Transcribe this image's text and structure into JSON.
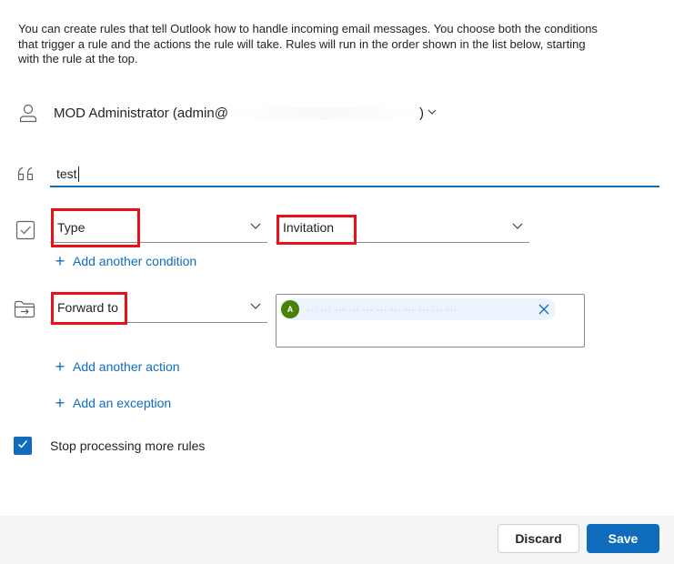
{
  "intro_text": "You can create rules that tell Outlook how to handle incoming email messages. You choose both the conditions that trigger a rule and the actions the rule will take. Rules will run in the order shown in the list below, starting with the rule at the top.",
  "account": {
    "label": "MOD Administrator (admin@",
    "suffix": ")",
    "icon": "person-icon"
  },
  "rule_name": {
    "value": "test",
    "icon": "quote-icon"
  },
  "condition": {
    "icon": "checkbox-icon",
    "type_value": "Type",
    "value": "Invitation",
    "add_label": "Add another condition"
  },
  "action": {
    "icon": "folder-arrow-icon",
    "type_value": "Forward to",
    "recipient_initial": "A",
    "recipient_text": "··· ··· ··· ··· ··· ··· ··· ··· ··· ··· ···",
    "add_label": "Add another action"
  },
  "exception": {
    "add_label": "Add an exception"
  },
  "stop_processing": {
    "label": "Stop processing more rules",
    "checked": true
  },
  "buttons": {
    "discard": "Discard",
    "save": "Save"
  },
  "colors": {
    "accent": "#0f6cbd",
    "highlight_box": "#e8101b",
    "avatar": "#498205"
  }
}
